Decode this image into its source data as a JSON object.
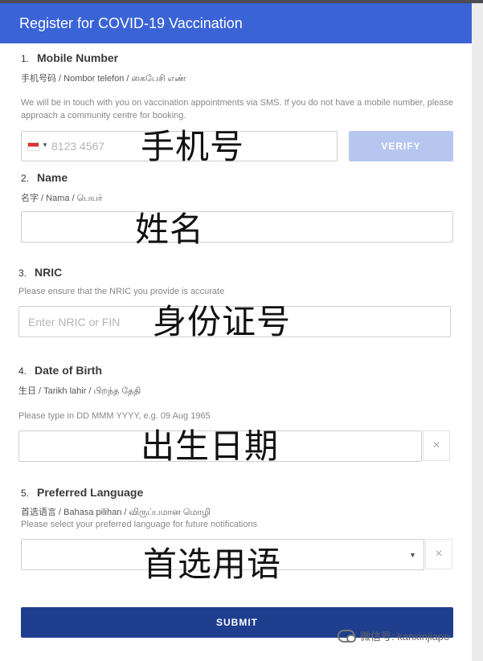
{
  "header": {
    "title": "Register for COVID-19 Vaccination"
  },
  "fields": {
    "mobile": {
      "number": "1.",
      "label": "Mobile Number",
      "translations": "手机号码 / Nombor telefon / கைபேசி எண்",
      "hint": "We will be in touch with you on vaccination appointments via SMS. If you do not have a mobile number, please approach a community centre for booking.",
      "placeholder": "8123 4567",
      "verify_label": "VERIFY",
      "overlay": "手机号"
    },
    "name": {
      "number": "2.",
      "label": "Name",
      "translations": "名字 / Nama / பெயர்",
      "overlay": "姓名"
    },
    "nric": {
      "number": "3.",
      "label": "NRIC",
      "hint": "Please ensure that the NRIC you provide is accurate",
      "placeholder": "Enter NRIC or FIN",
      "overlay": "身份证号"
    },
    "dob": {
      "number": "4.",
      "label": "Date of Birth",
      "translations": "生日 / Tarikh lahir / பிறந்த தேதி",
      "hint": "Please type in DD MMM YYYY, e.g. 09 Aug 1965",
      "overlay": "出生日期",
      "clear": "×"
    },
    "language": {
      "number": "5.",
      "label": "Preferred Language",
      "translations": "首选语言 / Bahasa pilihan / விருப்பமான மொழி",
      "hint": "Please select your preferred language for future notifications",
      "overlay": "首选用语",
      "clear": "×"
    }
  },
  "submit_label": "SUBMIT",
  "watermark": "微信号: kanxinjiapo",
  "colors": {
    "header": "#3a63d6",
    "verify": "#b7c6ef",
    "submit": "#1f3e8e"
  }
}
